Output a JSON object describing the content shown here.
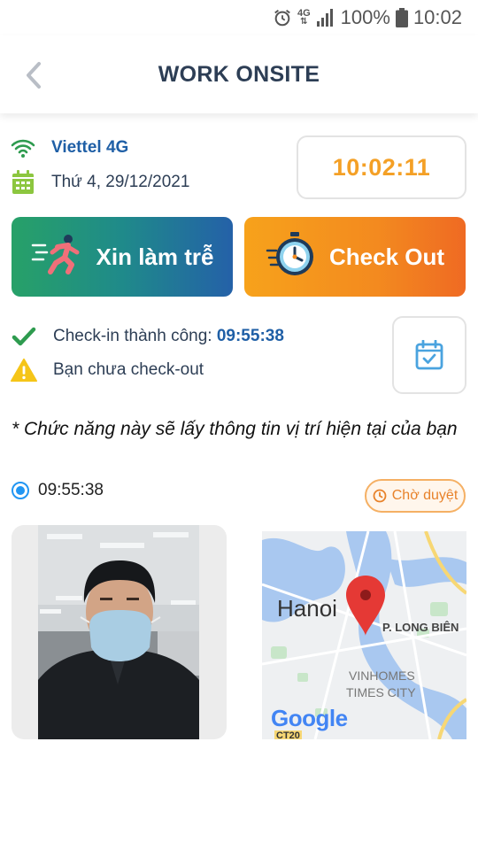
{
  "status_bar": {
    "network": "4G",
    "battery": "100%",
    "time": "10:02"
  },
  "header": {
    "title": "WORK ONSITE"
  },
  "info": {
    "network_name": "Viettel 4G",
    "date": "Thứ 4, 29/12/2021",
    "clock": "10:02:11"
  },
  "actions": {
    "late_label": "Xin làm trễ",
    "checkout_label": "Check Out"
  },
  "status": {
    "checkin_label": "Check-in thành công: ",
    "checkin_time": "09:55:38",
    "checkout_warning": "Bạn chưa check-out"
  },
  "note": "* Chức năng này sẽ lấy thông tin vị trí hiện tại của bạn",
  "record": {
    "time": "09:55:38",
    "badge": "Chờ duyệt"
  },
  "map": {
    "city": "Hanoi",
    "district": "P. LONG BIÊN",
    "area_line1": "VINHOMES",
    "area_line2": "TIMES CITY",
    "brand": "Google",
    "road_code": "CT20"
  },
  "colors": {
    "accent_blue": "#1f5fa6",
    "clock_orange": "#f4a026",
    "success_green": "#2e9b4f",
    "warning_yellow": "#f5c518"
  },
  "icons": {
    "back": "chevron-left-icon",
    "wifi": "wifi-icon",
    "calendar": "calendar-icon",
    "runner": "runner-icon",
    "stopwatch": "stopwatch-icon",
    "check": "check-icon",
    "warning": "warning-icon",
    "calendar_check": "calendar-check-icon",
    "clock": "clock-icon",
    "map_pin": "map-pin-icon"
  }
}
